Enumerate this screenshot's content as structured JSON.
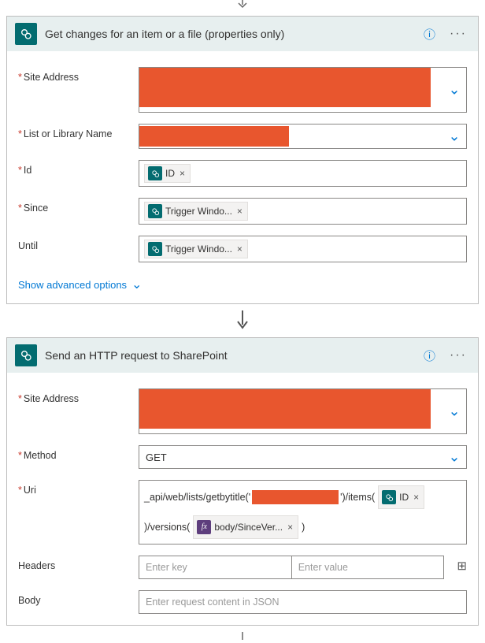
{
  "card1": {
    "title": "Get changes for an item or a file (properties only)",
    "fields": {
      "siteAddress": "Site Address",
      "listOrLibrary": "List or Library Name",
      "id": "Id",
      "since": "Since",
      "until": "Until"
    },
    "tokens": {
      "id": "ID",
      "since": "Trigger Windo...",
      "until": "Trigger Windo..."
    },
    "showAdvanced": "Show advanced options"
  },
  "card2": {
    "title": "Send an HTTP request to SharePoint",
    "fields": {
      "siteAddress": "Site Address",
      "method": "Method",
      "uri": "Uri",
      "headers": "Headers",
      "body": "Body"
    },
    "methodValue": "GET",
    "uri": {
      "prefix": "_api/web/lists/getbytitle('",
      "mid1": "')/items(",
      "tokenId": "ID",
      "mid2": ")/versions(",
      "tokenSince": "body/SinceVer...",
      "suffix": ")"
    },
    "headersKeyPlaceholder": "Enter key",
    "headersValuePlaceholder": "Enter value",
    "bodyPlaceholder": "Enter request content in JSON"
  },
  "icons": {
    "help": "?",
    "more": "···"
  }
}
